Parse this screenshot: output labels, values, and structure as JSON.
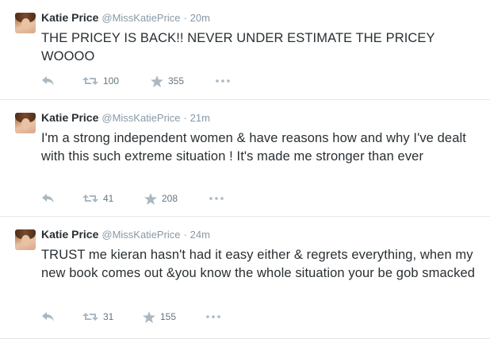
{
  "tweets": [
    {
      "name": "Katie Price",
      "handle": "@MissKatiePrice",
      "separator": "·",
      "time": "20m",
      "text": "THE PRICEY IS BACK!! NEVER UNDER ESTIMATE THE PRICEY WOOOO",
      "retweets": "100",
      "favorites": "355"
    },
    {
      "name": "Katie Price",
      "handle": "@MissKatiePrice",
      "separator": "·",
      "time": "21m",
      "text": "I'm a strong independent women & have reasons how and why I've dealt with this such extreme situation ! It's made me stronger than ever",
      "retweets": "41",
      "favorites": "208"
    },
    {
      "name": "Katie Price",
      "handle": "@MissKatiePrice",
      "separator": "·",
      "time": "24m",
      "text": "TRUST me kieran hasn't had it easy either & regrets everything, when my new book comes out &you know the whole situation your be gob smacked",
      "retweets": "31",
      "favorites": "155"
    }
  ],
  "icons": {
    "reply": "reply-icon",
    "retweet": "retweet-icon",
    "favorite": "star-icon",
    "more": "more-icon"
  },
  "colors": {
    "text": "#292f33",
    "muted": "#8899a6",
    "icon": "#aab8c2",
    "border": "#e1e8ed"
  }
}
